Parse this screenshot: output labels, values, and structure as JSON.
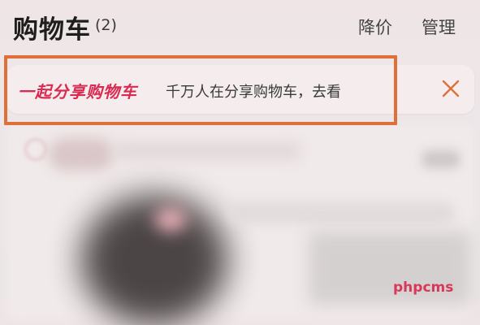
{
  "header": {
    "title": "购物车",
    "count": "(2)",
    "price_drop_label": "降价",
    "manage_label": "管理"
  },
  "banner": {
    "title": "一起分享购物车",
    "subtitle": "千万人在分享购物车，去看"
  },
  "watermark": "phpcms",
  "colors": {
    "accent": "#d92a50",
    "highlight_border": "#e0703a",
    "close_icon": "#e0703a"
  }
}
